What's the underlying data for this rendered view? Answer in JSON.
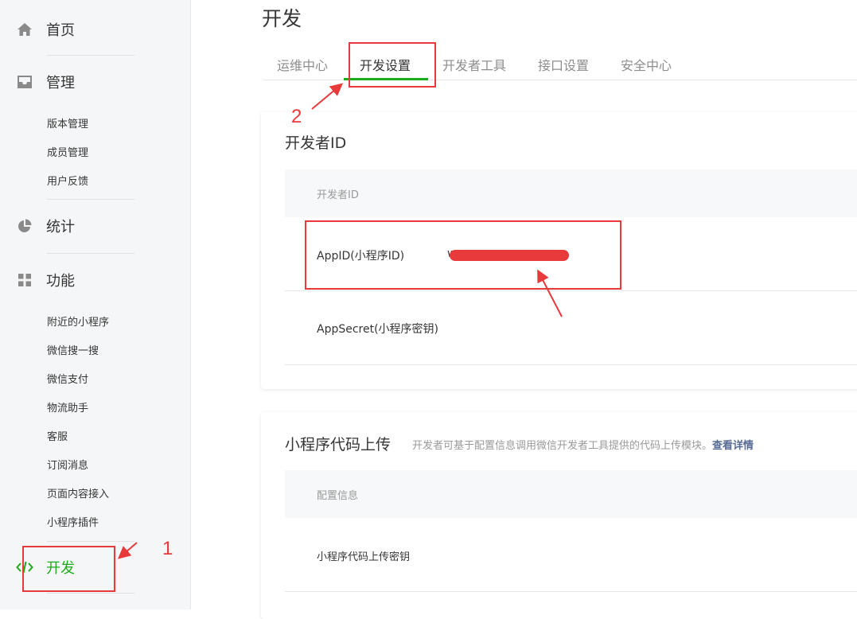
{
  "sidebar": {
    "home": {
      "label": "首页"
    },
    "manage": {
      "label": "管理",
      "items": [
        "版本管理",
        "成员管理",
        "用户反馈"
      ]
    },
    "stats": {
      "label": "统计"
    },
    "features": {
      "label": "功能",
      "items": [
        "附近的小程序",
        "微信搜一搜",
        "微信支付",
        "物流助手",
        "客服",
        "订阅消息",
        "页面内容接入",
        "小程序插件"
      ]
    },
    "dev": {
      "label": "开发"
    }
  },
  "main": {
    "title": "开发",
    "tabs": [
      "运维中心",
      "开发设置",
      "开发者工具",
      "接口设置",
      "安全中心"
    ],
    "active_tab": "开发设置"
  },
  "developer_id_card": {
    "title": "开发者ID",
    "header_label": "开发者ID",
    "appid_label": "AppID(小程序ID)",
    "appid_value_partial": "w",
    "appsecret_label": "AppSecret(小程序密钥)"
  },
  "upload_card": {
    "title": "小程序代码上传",
    "description": "开发者可基于配置信息调用微信开发者工具提供的代码上传模块。",
    "details_link": "查看详情",
    "header_label": "配置信息",
    "key_label": "小程序代码上传密钥"
  },
  "annotations": {
    "step1": "1",
    "step2": "2",
    "color": "#e8393b"
  },
  "colors": {
    "accent": "#1aad19",
    "link": "#576b95",
    "sidebar_bg": "#f5f6f7"
  }
}
